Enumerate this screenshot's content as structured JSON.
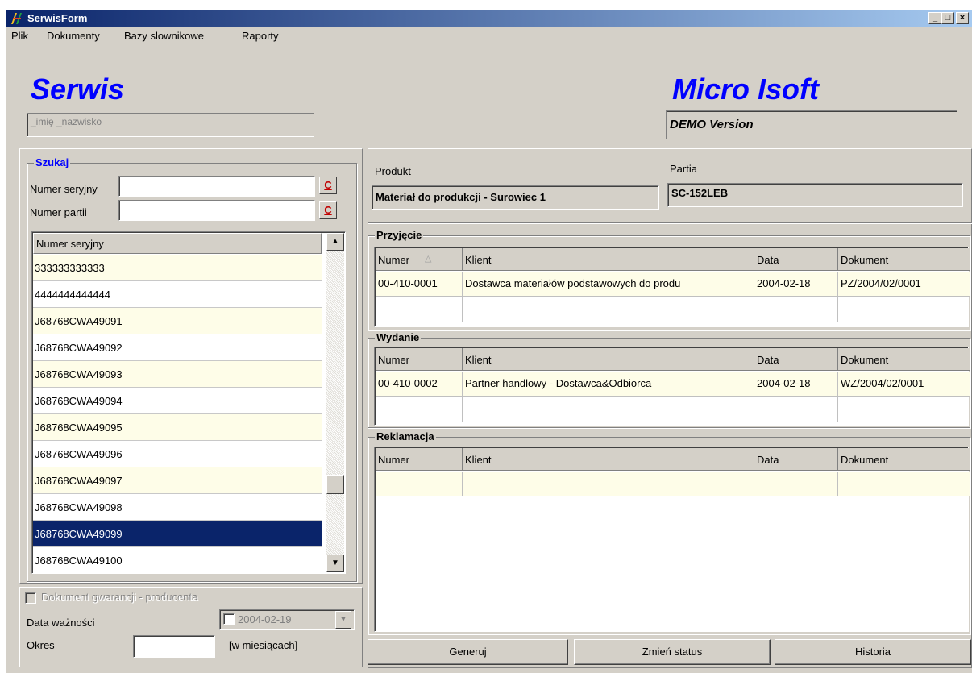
{
  "window": {
    "title": "SerwisForm",
    "min": "_",
    "max": "□",
    "close": "×"
  },
  "menu": [
    "Plik",
    "Dokumenty",
    "Bazy slownikowe",
    "Raporty"
  ],
  "header": {
    "left_brand": "Serwis",
    "user_field": "_imię _nazwisko",
    "right_brand": "Micro Isoft",
    "version": "DEMO Version"
  },
  "search": {
    "title": "Szukaj",
    "serial_label": "Numer seryjny",
    "serial_value": "",
    "lot_label": "Numer partii",
    "lot_value": "",
    "clear_label": "C"
  },
  "serial_list": {
    "header": "Numer seryjny",
    "items": [
      "333333333333",
      "4444444444444",
      "J68768CWA49091",
      "J68768CWA49092",
      "J68768CWA49093",
      "J68768CWA49094",
      "J68768CWA49095",
      "J68768CWA49096",
      "J68768CWA49097",
      "J68768CWA49098",
      "J68768CWA49099",
      "J68768CWA49100"
    ],
    "selected_index": 10
  },
  "warranty": {
    "checkbox_label": "Dokument gwarancji - producenta",
    "expiry_label": "Data ważności",
    "expiry_value": "2004-02-19",
    "period_label": "Okres",
    "period_value": "",
    "period_unit": "[w miesiącach]"
  },
  "product": {
    "product_label": "Produkt",
    "product_value": "Materiał do produkcji - Surowiec 1",
    "lot_label": "Partia",
    "lot_value": "SC-152LEB"
  },
  "receipt": {
    "title": "Przyjęcie",
    "columns": [
      "Numer",
      "Klient",
      "Data",
      "Dokument"
    ],
    "rows": [
      [
        "00-410-0001",
        "Dostawca materiałów podstawowych do produ",
        "2004-02-18",
        "PZ/2004/02/0001"
      ]
    ]
  },
  "issue": {
    "title": "Wydanie",
    "columns": [
      "Numer",
      "Klient",
      "Data",
      "Dokument"
    ],
    "rows": [
      [
        "00-410-0002",
        "Partner handlowy - Dostawca&Odbiorca",
        "2004-02-18",
        "WZ/2004/02/0001"
      ]
    ]
  },
  "complaint": {
    "title": "Reklamacja",
    "columns": [
      "Numer",
      "Klient",
      "Data",
      "Dokument"
    ],
    "rows": []
  },
  "actions": {
    "generate": "Generuj",
    "change_status": "Zmień status",
    "history": "Historia"
  },
  "colors": {
    "row_alt": "#fefde8",
    "selected": "#0a246a",
    "brand": "#0000ff"
  }
}
